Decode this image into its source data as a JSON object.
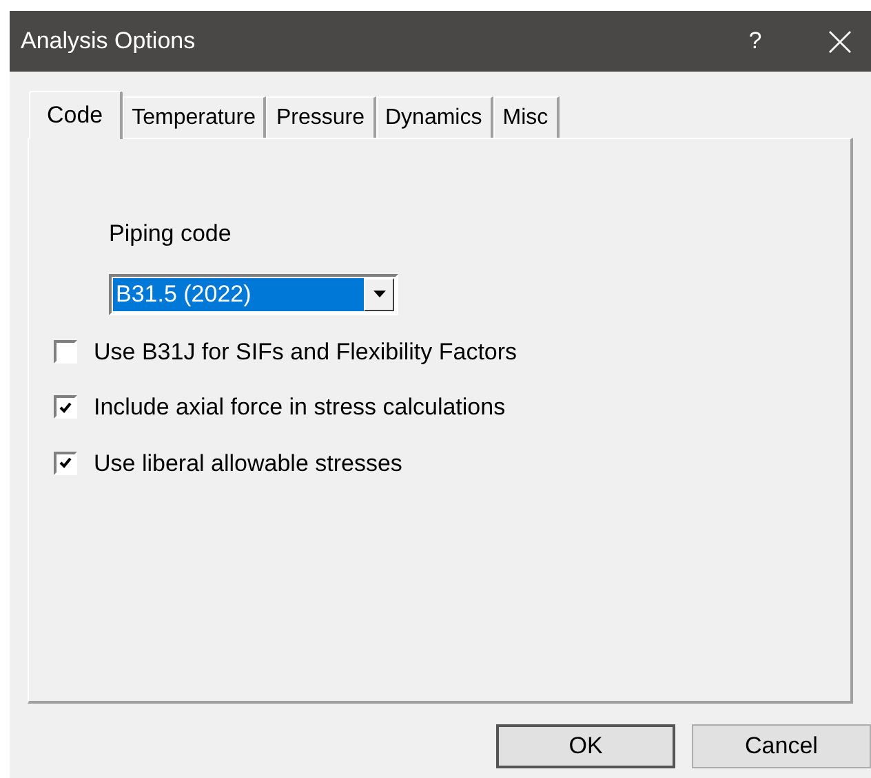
{
  "window": {
    "title": "Analysis Options",
    "help": "?"
  },
  "tabs": [
    {
      "label": "Code",
      "selected": true
    },
    {
      "label": "Temperature",
      "selected": false
    },
    {
      "label": "Pressure",
      "selected": false
    },
    {
      "label": "Dynamics",
      "selected": false
    },
    {
      "label": "Misc",
      "selected": false
    }
  ],
  "piping_code": {
    "label": "Piping code",
    "value": "B31.5 (2022)"
  },
  "options": [
    {
      "label": "Use B31J for SIFs and Flexibility Factors",
      "checked": false
    },
    {
      "label": "Include axial force in stress calculations",
      "checked": true
    },
    {
      "label": "Use liberal allowable stresses",
      "checked": true
    }
  ],
  "buttons": [
    {
      "label": "OK",
      "default": true
    },
    {
      "label": "Cancel",
      "default": false
    }
  ]
}
